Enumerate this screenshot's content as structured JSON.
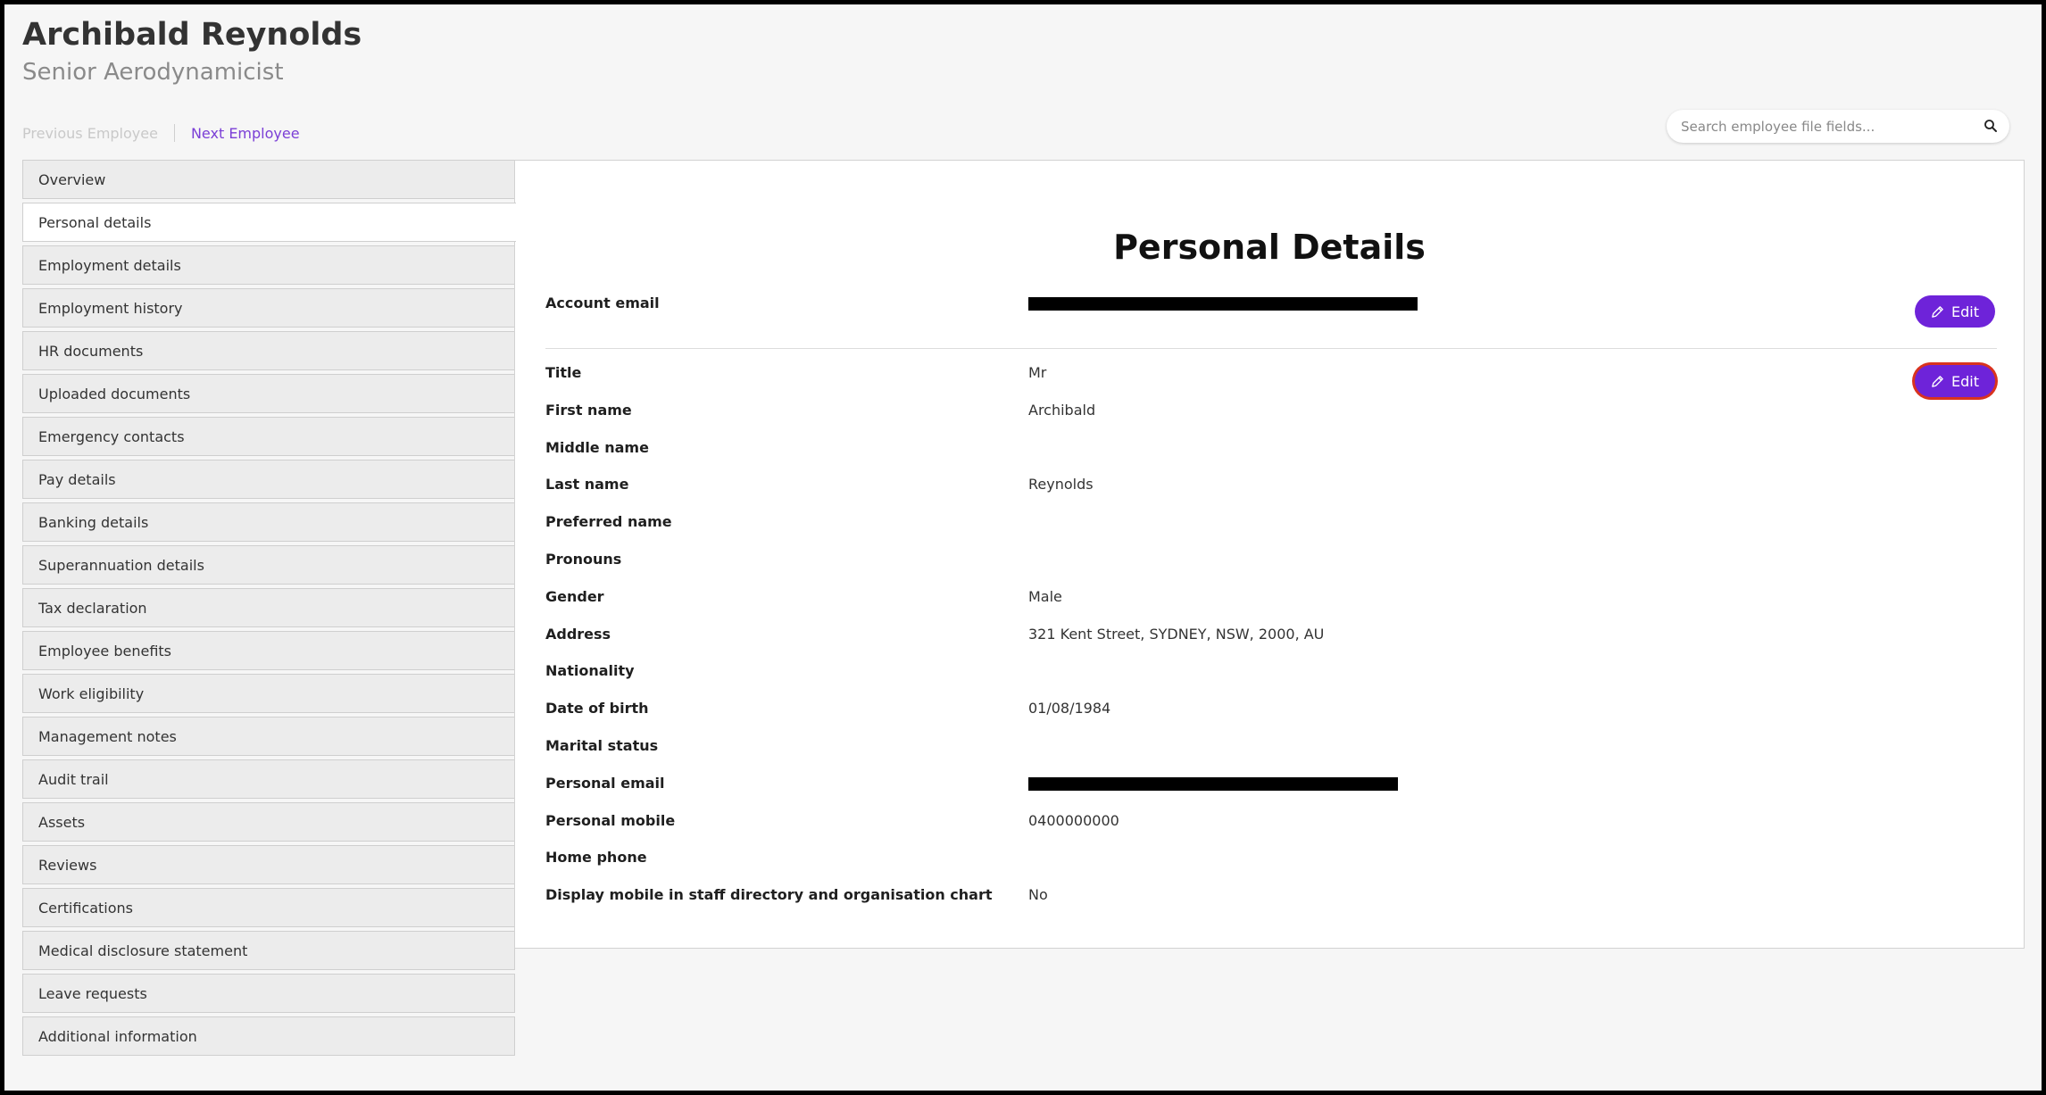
{
  "header": {
    "name": "Archibald Reynolds",
    "role": "Senior Aerodynamicist",
    "prev_label": "Previous Employee",
    "next_label": "Next Employee"
  },
  "search": {
    "placeholder": "Search employee file fields...",
    "icon": "search-icon"
  },
  "sidebar": {
    "items": [
      {
        "label": "Overview"
      },
      {
        "label": "Personal details",
        "active": true
      },
      {
        "label": "Employment details"
      },
      {
        "label": "Employment history"
      },
      {
        "label": "HR documents"
      },
      {
        "label": "Uploaded documents"
      },
      {
        "label": "Emergency contacts"
      },
      {
        "label": "Pay details"
      },
      {
        "label": "Banking details"
      },
      {
        "label": "Superannuation details"
      },
      {
        "label": "Tax declaration"
      },
      {
        "label": "Employee benefits"
      },
      {
        "label": "Work eligibility"
      },
      {
        "label": "Management notes"
      },
      {
        "label": "Audit trail"
      },
      {
        "label": "Assets"
      },
      {
        "label": "Reviews"
      },
      {
        "label": "Certifications"
      },
      {
        "label": "Medical disclosure statement"
      },
      {
        "label": "Leave requests"
      },
      {
        "label": "Additional information"
      }
    ]
  },
  "panel": {
    "title": "Personal Details",
    "edit_label": "Edit",
    "account": {
      "label": "Account email",
      "redacted": true
    },
    "fields": [
      {
        "label": "Title",
        "value": "Mr"
      },
      {
        "label": "First name",
        "value": "Archibald"
      },
      {
        "label": "Middle name",
        "value": ""
      },
      {
        "label": "Last name",
        "value": "Reynolds"
      },
      {
        "label": "Preferred name",
        "value": ""
      },
      {
        "label": "Pronouns",
        "value": ""
      },
      {
        "label": "Gender",
        "value": "Male"
      },
      {
        "label": "Address",
        "value": "321 Kent Street, SYDNEY, NSW, 2000, AU"
      },
      {
        "label": "Nationality",
        "value": ""
      },
      {
        "label": "Date of birth",
        "value": "01/08/1984"
      },
      {
        "label": "Marital status",
        "value": ""
      },
      {
        "label": "Personal email",
        "value": "",
        "redacted": true
      },
      {
        "label": "Personal mobile",
        "value": "0400000000"
      },
      {
        "label": "Home phone",
        "value": ""
      },
      {
        "label": "Display mobile in staff directory and organisation chart",
        "value": "No"
      }
    ]
  },
  "colors": {
    "accent": "#6e23d9",
    "focus_ring": "#d9331f",
    "link": "#7b3fd6"
  }
}
